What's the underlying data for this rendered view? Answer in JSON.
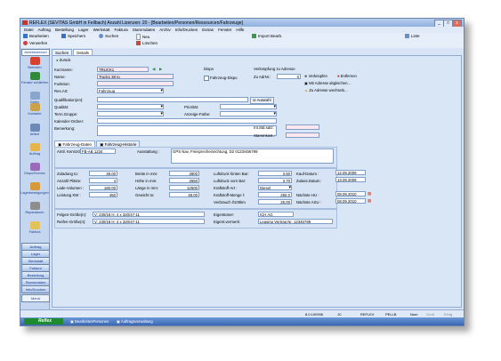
{
  "window": {
    "title": "REFLEX (SEVITAS GmbH in Fellbach) Anzahl Lizenzen: 20 - [Bearbeiten/Personen/Ressourcen/Fahrzeuge]",
    "controls": {
      "minimize": "_",
      "maximize": "□",
      "close": "x"
    }
  },
  "menu": [
    "Datei",
    "Auftrag",
    "Bestellung",
    "Lager",
    "Werkstatt",
    "Faktura",
    "Stammdaten",
    "Archiv",
    "Info/Drucken",
    "Extras",
    "Fenster",
    "Hilfe"
  ],
  "toolbar": {
    "bearbeiten": "Bearbeiten",
    "speichern": "Speichern",
    "suchen": "Suchen",
    "neu": "Neu",
    "loeschen": "Löschen",
    "import": "Import Bearb.",
    "liste": "Liste",
    "verwerfen": "Verwerfen"
  },
  "sidebar": {
    "tab": "Arbeitsbereich",
    "items": [
      "Beenden",
      "Fenster schließen",
      "Daten",
      "Kontakte",
      "Artikel",
      "Auftrag",
      "Dispo/Service",
      "Lagerbewegungen",
      "Reparaturen",
      "Faktura"
    ],
    "buttons": [
      "Auftrag",
      "Lager",
      "Werkstatt",
      "Faktura",
      "Bestellung",
      "Stammdaten",
      "Info/Drucken"
    ],
    "menu_label": "Menü"
  },
  "tabs": {
    "suchen": "Suchen",
    "details": "Details"
  },
  "form": {
    "zurueck": "Zurück",
    "kurzname_label": "Kurzname:",
    "kurzname": "TRUCK1",
    "name_label": "Name:",
    "name": "Truck1 38 to",
    "funktion_label": "Funktion:",
    "funktion": "",
    "resart_label": "Res.Art:",
    "resart": "Fahrzeug",
    "qualifikation_label": "Qualifikation(en):",
    "qualifikation": "",
    "auswahl": "Auswahl",
    "qualitaet_label": "Qualität:",
    "qualitaet": "",
    "prioritaet_label": "Priorität:",
    "prioritaet": "",
    "termgruppe_label": "Term.Gruppe:",
    "termgruppe": "",
    "anzeigefarbe_label": "Anzeige-Farbe:",
    "anzeigefarbe": "",
    "kalenderordner_label": "Kalender-Ordner:",
    "kalenderordner": "",
    "bemerkung_label": "Bemerkung:",
    "bemerkung": "",
    "dispo_label": "Dispo",
    "fahrzeugdispo": "Fahrzeug-Dispo",
    "verknuepfung_label": "Verknüpfung zu Adresse",
    "zuadrnr_label": "Zu AdrNr.:",
    "zuadrnr": "0",
    "verknuepfen": "Verknüpfen",
    "entfernen": "Entfernen",
    "mitadresse": "Mit Adresse abgleichen...",
    "zuadressewechseln": "Zu Adresse wechseln...",
    "intstdsatz_label": "Int.Std.satz:",
    "intstdsatz": "",
    "stammkost_label": "Stammkost.:",
    "stammkost": ""
  },
  "subtabs": {
    "daten": "Fahrzeug-Daten",
    "historie": "Fahrzeug-Historie"
  },
  "vehicle": {
    "kennzeichen_label": "Amtl. Kennzch.",
    "kennzeichen": "FB-AB 1234",
    "ausstattung_label": "Ausstattung :",
    "ausstattung": "GPS Nav, Freisprecheinrichtung, D2 0123/456789",
    "zuladung_label": "Zuladung to:",
    "zuladung": "38,00",
    "plaetze_label": "Anzahl Plätze:",
    "plaetze": "4",
    "ladevolumen_label": "Lade-Volumen :",
    "ladevolumen": "180,00",
    "leistung_label": "Leistung KW :",
    "leistung": "450",
    "breite_label": "Breite in mm:",
    "breite": "2800",
    "hoehe_label": "Höhe in mm:",
    "hoehe": "2550",
    "laenge_label": "Länge in mm:",
    "laenge": "12500",
    "gewicht_label": "Gewicht to:",
    "gewicht": "48,00",
    "lufthinten_label": "Luftdruck hinten Bar:",
    "lufthinten": "3,50",
    "luftvorn_label": "Luftdruck vorn Bar:",
    "luftvorn": "3,70",
    "kraftstoffart_label": "Kraftstoff-Art :",
    "kraftstoffart": "Diesel",
    "kraftstoffmenge_label": "Kraftstoff-Menge l:",
    "kraftstoffmenge": "250,0",
    "verbrauch_label": "Verbrauch l/100km",
    "verbrauch": "25,00",
    "kaufdatum_label": "Kauf-Datum :",
    "kaufdatum": "12.09.2009",
    "zulassdatum_label": "Zulass.Datum:",
    "zulassdatum": "13.09.2009",
    "naechstehu_label": "Nächste HU :",
    "naechstehu": "08.09.2010",
    "naechsteasu_label": "Nächste ASU :",
    "naechsteasu": "08.09.2010",
    "felgen_label": "Felgen-Größe(n):",
    "felgen": "V: 230/18 H: 4 x 320/47-11",
    "reifen_label": "Reifen-Größe(n):",
    "reifen": "V: 230/18 H: 4 x 320/47-11",
    "eigentuemer_label": "Eigentümer:",
    "eigentuemer": "ICH AG",
    "eigentvermerk_label": "Eigent.vermerk:",
    "eigentvermerk": "Leasing Vertrag Nr. 12346789"
  },
  "status": {
    "version": "8.0.100906",
    "user": "JC",
    "app": "REFLEX",
    "db": "PELLB",
    "num": "Num",
    "cap": "Groß",
    "scroll": "Einfg"
  },
  "taskbar": {
    "logo": "Reflex",
    "item1": "BearbeitenPersonen",
    "item2": "Auftragsverwaltung"
  }
}
